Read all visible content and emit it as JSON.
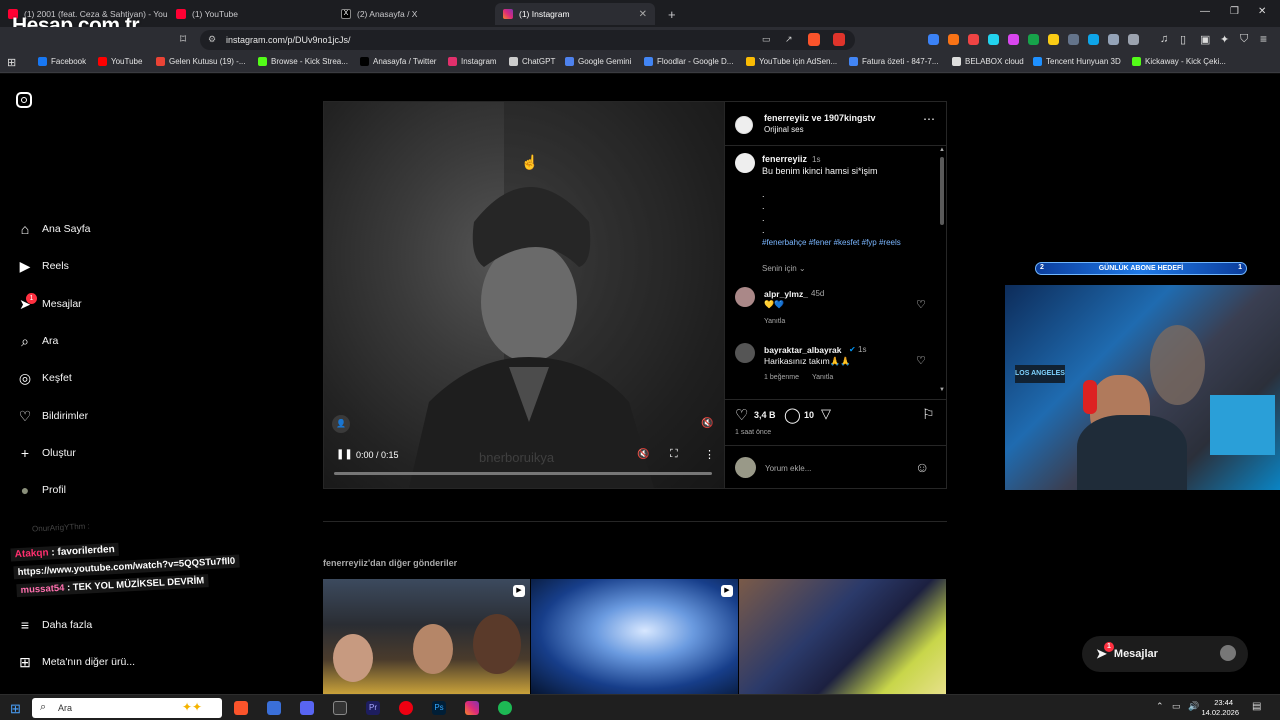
{
  "browser": {
    "tabs": [
      {
        "label": "(1) 2001 (feat. Ceza & Sahtiyan) - You",
        "color": "#ff0033"
      },
      {
        "label": "(1) YouTube",
        "color": "#ff0033"
      },
      {
        "label": "(2) Anasayfa / X",
        "color": "#000000"
      },
      {
        "label": "(1) Instagram",
        "color": "#e1306c"
      }
    ],
    "new_tab": "+",
    "url": "instagram.com/p/DUv9no1jcJs/",
    "watermark": "Hesap.com.tr",
    "bookmarks": [
      {
        "label": "Facebook",
        "color": "#1877f2"
      },
      {
        "label": "YouTube",
        "color": "#ff0000"
      },
      {
        "label": "Gelen Kutusu (19) -...",
        "color": "#ea4335"
      },
      {
        "label": "Browse - Kick Strea...",
        "color": "#53fc18"
      },
      {
        "label": "Anasayfa / Twitter",
        "color": "#000000"
      },
      {
        "label": "Instagram",
        "color": "#e1306c"
      },
      {
        "label": "ChatGPT",
        "color": "#cccccc"
      },
      {
        "label": "Google Gemini",
        "color": "#4e82ee"
      },
      {
        "label": "Floodlar - Google D...",
        "color": "#4285f4"
      },
      {
        "label": "YouTube için AdSen...",
        "color": "#fbbc04"
      },
      {
        "label": "Fatura özeti - 847-7...",
        "color": "#4285f4"
      },
      {
        "label": "BELABOX cloud",
        "color": "#dddddd"
      },
      {
        "label": "Tencent Hunyuan 3D",
        "color": "#1e90ff"
      },
      {
        "label": "Kickaway - Kick Çeki...",
        "color": "#53fc18"
      }
    ]
  },
  "sidebar": {
    "items": [
      {
        "label": "Ana Sayfa",
        "icon": "home-icon",
        "glyph": "⌂"
      },
      {
        "label": "Reels",
        "icon": "reels-icon",
        "glyph": "▶"
      },
      {
        "label": "Mesajlar",
        "icon": "messages-icon",
        "glyph": "➤"
      },
      {
        "label": "Ara",
        "icon": "search-icon",
        "glyph": "⌕"
      },
      {
        "label": "Keşfet",
        "icon": "explore-icon",
        "glyph": "◎"
      },
      {
        "label": "Bildirimler",
        "icon": "heart-icon",
        "glyph": "♡"
      },
      {
        "label": "Oluştur",
        "icon": "plus-icon",
        "glyph": "+"
      },
      {
        "label": "Profil",
        "icon": "profile-avatar",
        "glyph": "●"
      }
    ],
    "messages_badge": "1",
    "more_label": "Daha fazla",
    "meta_label": "Meta'nın diğer ürü..."
  },
  "post": {
    "header_title": "fenerreyiiz ve 1907kingstv",
    "header_sub": "Orijinal ses",
    "caption_user": "fenerreyiiz",
    "caption_time": "1s",
    "caption_text": "Bu benim ikinci hamsi si*işim",
    "hashtags": "#fenerbahçe #fener #kesfet #fyp #reels",
    "sort_label": "Senin için",
    "comments": [
      {
        "user": "alpr_ylmz_",
        "time": "45d",
        "text": "💛💙",
        "meta": "Yanıtla"
      },
      {
        "user": "bayraktar_albayrak",
        "time": "1s",
        "text": "Harikasınız takım🙏🙏",
        "likes": "1 beğenme",
        "meta": "Yanıtla"
      }
    ],
    "likes": "3,4 B",
    "comment_count": "10",
    "ago": "1 saat önce",
    "comment_placeholder": "Yorum ekle...",
    "video_time": "0:00 / 0:15",
    "video_watermark": "bnerboruikya",
    "video_progress": 0.0
  },
  "more_posts_label": "fenerreyiiz'dan diğer gönderiler",
  "overlay": {
    "goal_left": "2",
    "goal_label": "GÜNLÜK ABONE HEDEFİ",
    "goal_right": "1",
    "chat_ghost": "OnurArigYThm : ",
    "chat": [
      {
        "user": "Atakqn",
        "text": "favorilerden",
        "color": "#ff2f6e"
      },
      {
        "user": "",
        "text": "https://www.youtube.com/watch?v=5QQSTu7fIl0",
        "color": "#ffffff"
      },
      {
        "user": "mussat54",
        "text": "TEK YOL MÜZİKSEL DEVRİM",
        "color": "#ff6fae"
      }
    ]
  },
  "messages_float": {
    "label": "Mesajlar",
    "badge": "1"
  },
  "taskbar": {
    "search_placeholder": "Ara",
    "time": "23:44",
    "date": "14.02.2026"
  }
}
